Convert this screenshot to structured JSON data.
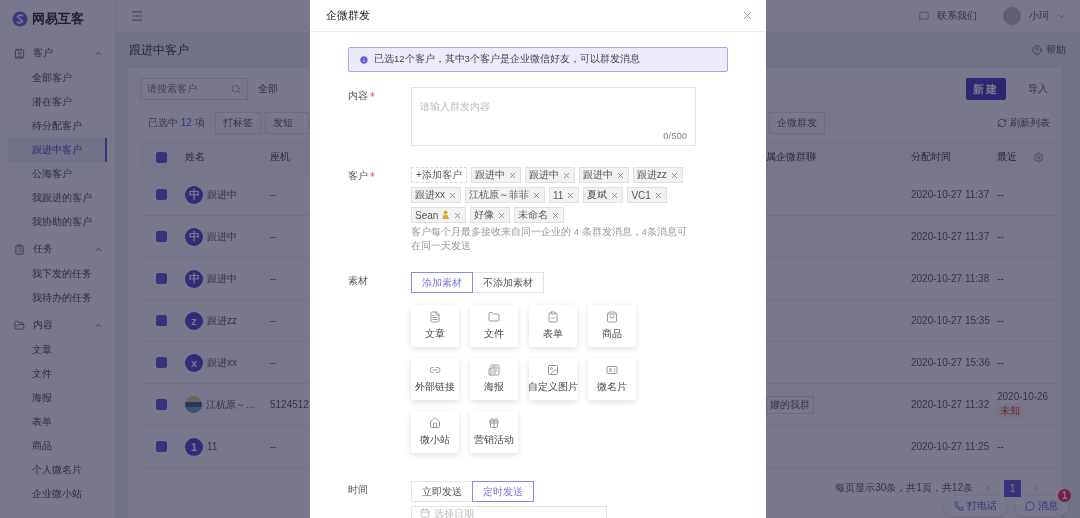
{
  "sidebar": {
    "logo": "网易互客",
    "groups": [
      {
        "label": "客户",
        "kind": "customer",
        "expanded": true,
        "items": [
          {
            "label": "全部客户",
            "selected": false
          },
          {
            "label": "潜在客户",
            "selected": false
          },
          {
            "label": "待分配客户",
            "selected": false
          },
          {
            "label": "跟进中客户",
            "selected": true
          },
          {
            "label": "公海客户",
            "selected": false
          },
          {
            "label": "我跟进的客户",
            "selected": false
          },
          {
            "label": "我协助的客户",
            "selected": false
          }
        ]
      },
      {
        "label": "任务",
        "kind": "task",
        "expanded": true,
        "items": [
          {
            "label": "我下发的任务",
            "selected": false
          },
          {
            "label": "我待办的任务",
            "selected": false
          }
        ]
      },
      {
        "label": "内容",
        "kind": "content",
        "expanded": true,
        "items": [
          {
            "label": "文章",
            "selected": false
          },
          {
            "label": "文件",
            "selected": false
          },
          {
            "label": "海报",
            "selected": false
          },
          {
            "label": "表单",
            "selected": false
          },
          {
            "label": "商品",
            "selected": false
          },
          {
            "label": "个人微名片",
            "selected": false
          },
          {
            "label": "企业微小站",
            "selected": false
          }
        ]
      }
    ]
  },
  "header": {
    "contact": "联系我们",
    "user": "小珂"
  },
  "page": {
    "title": "跟进中客户",
    "help": "帮助",
    "search_placeholder": "请搜索客户",
    "filter": "全部",
    "new_button": "新建",
    "import_button": "导入"
  },
  "toolbar": {
    "selected_prefix": "已选中",
    "selected_count": "12",
    "selected_suffix": "项",
    "buttons": [
      "打标签",
      "发短"
    ],
    "group_send": "企微群发",
    "refresh": "刷新列表"
  },
  "table": {
    "all_checked": true,
    "columns_left": [
      "姓名",
      "座机"
    ],
    "columns_right": [
      "属企微群聊",
      "分配时间",
      "最近"
    ],
    "rows": [
      {
        "checked": true,
        "avatar": "中",
        "name": "跟进中",
        "landline": "--",
        "assigned": "2020-10-27 11:37",
        "last": "--"
      },
      {
        "checked": true,
        "avatar": "中",
        "name": "跟进中",
        "landline": "--",
        "assigned": "2020-10-27 11:37",
        "last": "--"
      },
      {
        "checked": true,
        "avatar": "中",
        "name": "跟进中",
        "landline": "--",
        "assigned": "2020-10-27 11:38",
        "last": "--"
      },
      {
        "checked": true,
        "avatar": "z",
        "name": "跟进zz",
        "landline": "--",
        "assigned": "2020-10-27 15:35",
        "last": "--"
      },
      {
        "checked": true,
        "avatar": "x",
        "name": "跟进xx",
        "landline": "--",
        "assigned": "2020-10-27 15:36",
        "last": "--"
      },
      {
        "checked": true,
        "name": "江杭原～...",
        "landline": "5124512",
        "group_chat": "娜的我群",
        "assigned": "2020-10-27 11:32",
        "last": "2020-10-26",
        "last_tag": "未知"
      },
      {
        "checked": true,
        "avatar": "1",
        "name": "11",
        "landline": "--",
        "assigned": "2020-10-27 11:25",
        "last": "--"
      }
    ]
  },
  "pagination": {
    "summary": "每页显示30条，共1页，共12条",
    "pages": [
      {
        "label": "1",
        "selected": true
      }
    ]
  },
  "float_buttons": [
    {
      "label": "打电话",
      "kind": "phone"
    },
    {
      "label": "消息",
      "kind": "message",
      "badge": "1"
    }
  ],
  "dialog": {
    "title": "企微群发",
    "notice": "已选12个客户，其中3个客户是企业微信好友，可以群发消息",
    "content": {
      "label": "内容",
      "required": true,
      "placeholder": "请输入群发内容",
      "counter": "0/500"
    },
    "customers": {
      "label": "客户",
      "required": true,
      "add_button": "+添加客户",
      "tags": [
        {
          "label": "跟进中"
        },
        {
          "label": "跟进中"
        },
        {
          "label": "跟进中"
        },
        {
          "label": "跟进zz"
        },
        {
          "label": "跟进xx"
        },
        {
          "label": "江杭原～菲菲"
        },
        {
          "label": "11"
        },
        {
          "label": "夏斌"
        },
        {
          "label": "VC1"
        },
        {
          "label": "Sean",
          "kind": "figure"
        },
        {
          "label": "好像"
        },
        {
          "label": "未命名"
        }
      ],
      "hint": "客户每个月最多接收来自同一企业的 4 条群发消息，4条消息可在同一天发送"
    },
    "material": {
      "label": "素材",
      "options": [
        {
          "label": "添加素材",
          "selected": true
        },
        {
          "label": "不添加素材",
          "selected": false
        }
      ],
      "items": [
        {
          "label": "文章",
          "kind": "article"
        },
        {
          "label": "文件",
          "kind": "file"
        },
        {
          "label": "表单",
          "kind": "form"
        },
        {
          "label": "商品",
          "kind": "product"
        },
        {
          "label": "外部链接",
          "kind": "link"
        },
        {
          "label": "海报",
          "kind": "poster"
        },
        {
          "label": "自定义图片",
          "kind": "image"
        },
        {
          "label": "微名片",
          "kind": "card"
        },
        {
          "label": "微小站",
          "kind": "site"
        },
        {
          "label": "营销活动",
          "kind": "campaign"
        }
      ]
    },
    "time": {
      "label": "时间",
      "options": [
        {
          "label": "立即发送",
          "selected": false
        },
        {
          "label": "定时发送",
          "selected": true
        }
      ],
      "date_placeholder": "选择日期"
    }
  }
}
